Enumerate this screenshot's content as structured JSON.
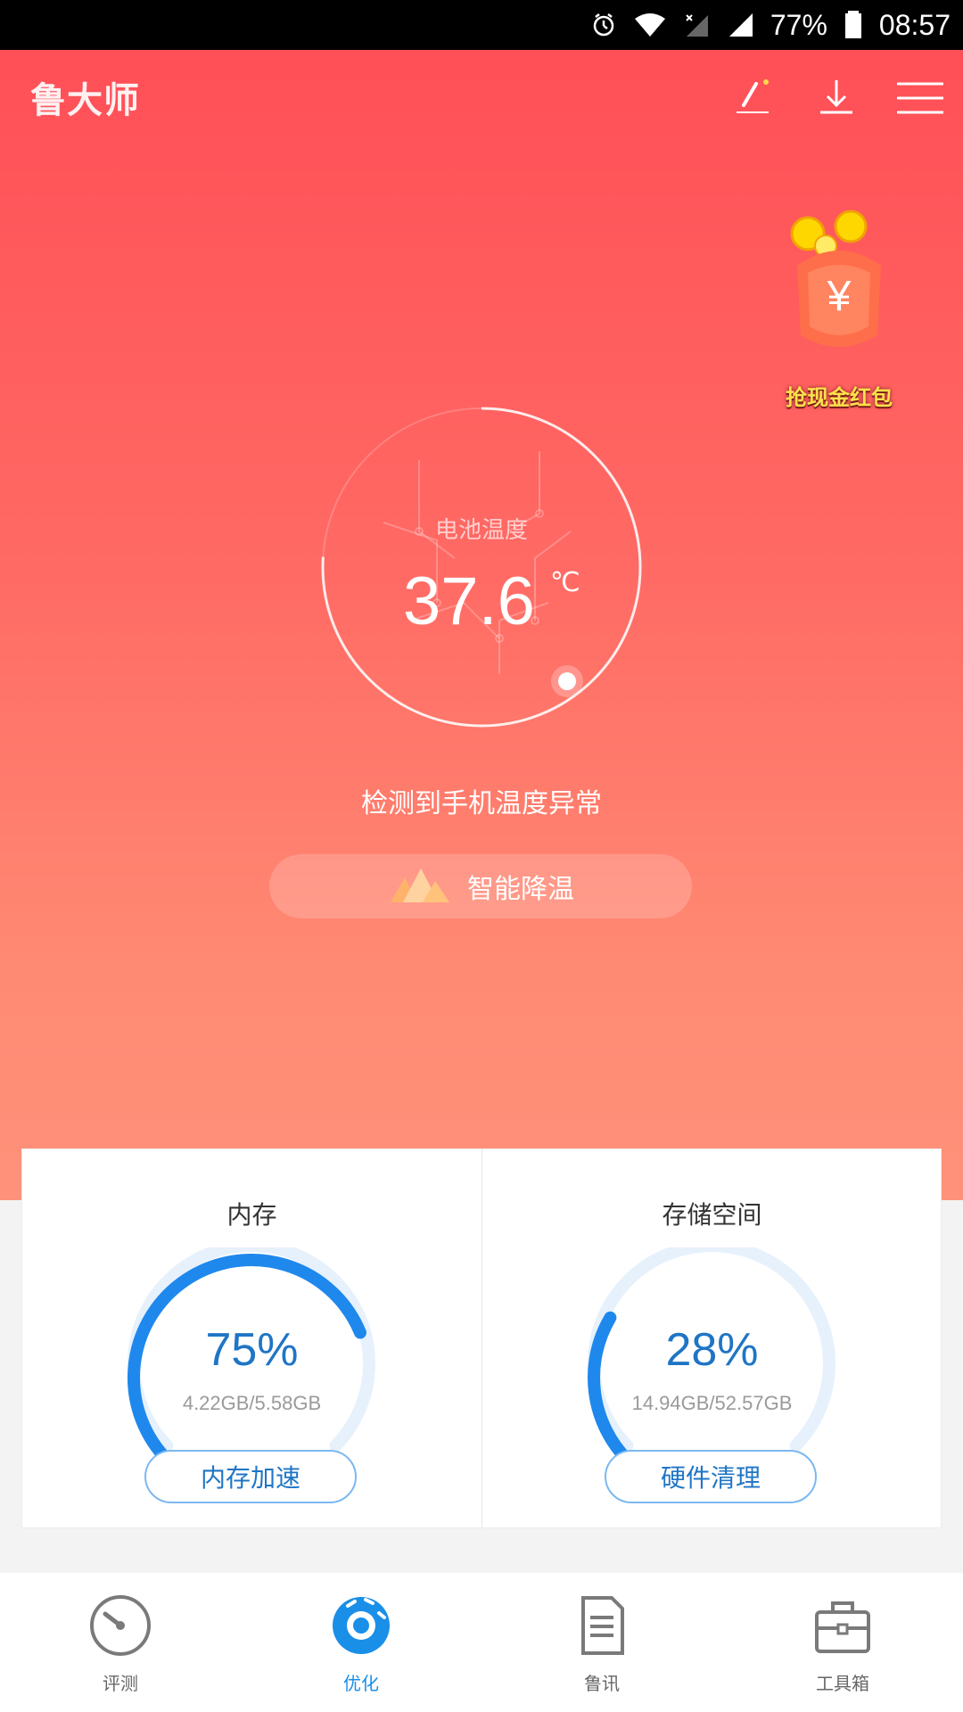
{
  "status_bar": {
    "battery": "77%",
    "time": "08:57",
    "icons": [
      "alarm-icon",
      "wifi-icon",
      "cellular-no-signal-icon",
      "cellular-signal-icon",
      "battery-icon"
    ]
  },
  "header": {
    "app_name": "鲁大师",
    "actions": [
      "edit-icon",
      "download-icon",
      "menu-icon"
    ]
  },
  "promo": {
    "text": "抢现金红包",
    "icon": "money-bag-icon"
  },
  "battery_gauge": {
    "label": "电池温度",
    "value": "37.6",
    "unit": "℃"
  },
  "alert": {
    "text": "检测到手机温度异常"
  },
  "cool_button": {
    "label": "智能降温",
    "icon": "mountain-icon"
  },
  "cards": {
    "memory": {
      "title": "内存",
      "percent": "75%",
      "fraction": 0.75,
      "detail": "4.22GB/5.58GB",
      "action": "内存加速"
    },
    "storage": {
      "title": "存储空间",
      "percent": "28%",
      "fraction": 0.28,
      "detail": "14.94GB/52.57GB",
      "action": "硬件清理"
    }
  },
  "bottom_nav": [
    {
      "label": "评测",
      "icon": "speedometer-icon",
      "active": false
    },
    {
      "label": "优化",
      "icon": "optimize-icon",
      "active": true
    },
    {
      "label": "鲁讯",
      "icon": "document-icon",
      "active": false
    },
    {
      "label": "工具箱",
      "icon": "toolbox-icon",
      "active": false
    }
  ],
  "colors": {
    "accent_blue": "#1a8fe8",
    "hero_top": "#ff4f57",
    "hero_bottom": "#ff917a"
  }
}
